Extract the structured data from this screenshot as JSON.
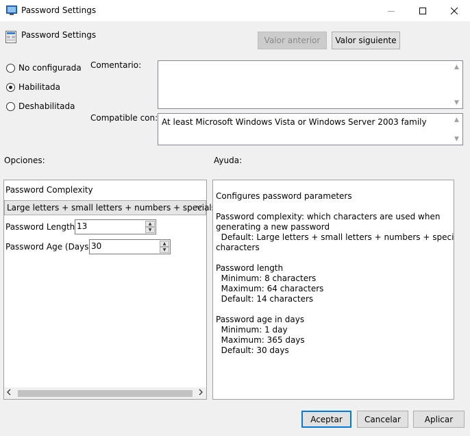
{
  "window": {
    "title": "Password Settings",
    "icon": "settings-window-icon",
    "controls": {
      "minimize": "minimize-icon",
      "maximize": "maximize-icon",
      "close": "close-icon"
    }
  },
  "header": {
    "setting_name": "Password Settings",
    "icon": "policy-icon"
  },
  "nav": {
    "previous": "Valor anterior",
    "next": "Valor siguiente"
  },
  "state_options": [
    {
      "label": "No configurada",
      "checked": false
    },
    {
      "label": "Habilitada",
      "checked": true
    },
    {
      "label": "Deshabilitada",
      "checked": false
    }
  ],
  "comment": {
    "label": "Comentario:",
    "value": ""
  },
  "supported": {
    "label": "Compatible con:",
    "value": "At least Microsoft Windows Vista or Windows Server 2003 family"
  },
  "options": {
    "label": "Opciones:",
    "complexity": {
      "label": "Password Complexity",
      "selected": "Large letters + small letters + numbers + specials"
    },
    "length": {
      "label": "Password Length",
      "value": "13"
    },
    "age": {
      "label": "Password Age (Days)",
      "value": "30"
    }
  },
  "help": {
    "label": "Ayuda:",
    "lines": [
      "Configures password parameters",
      "Password complexity: which characters are used when",
      "generating a new password",
      "  Default: Large letters + small letters + numbers + special",
      "characters",
      "Password length",
      "  Minimum: 8 characters",
      "  Maximum: 64 characters",
      "  Default: 14 characters",
      "Password age in days",
      "  Minimum: 1 day",
      "  Maximum: 365 days",
      "  Default: 30 days"
    ]
  },
  "footer": {
    "ok": "Aceptar",
    "cancel": "Cancelar",
    "apply": "Aplicar"
  }
}
